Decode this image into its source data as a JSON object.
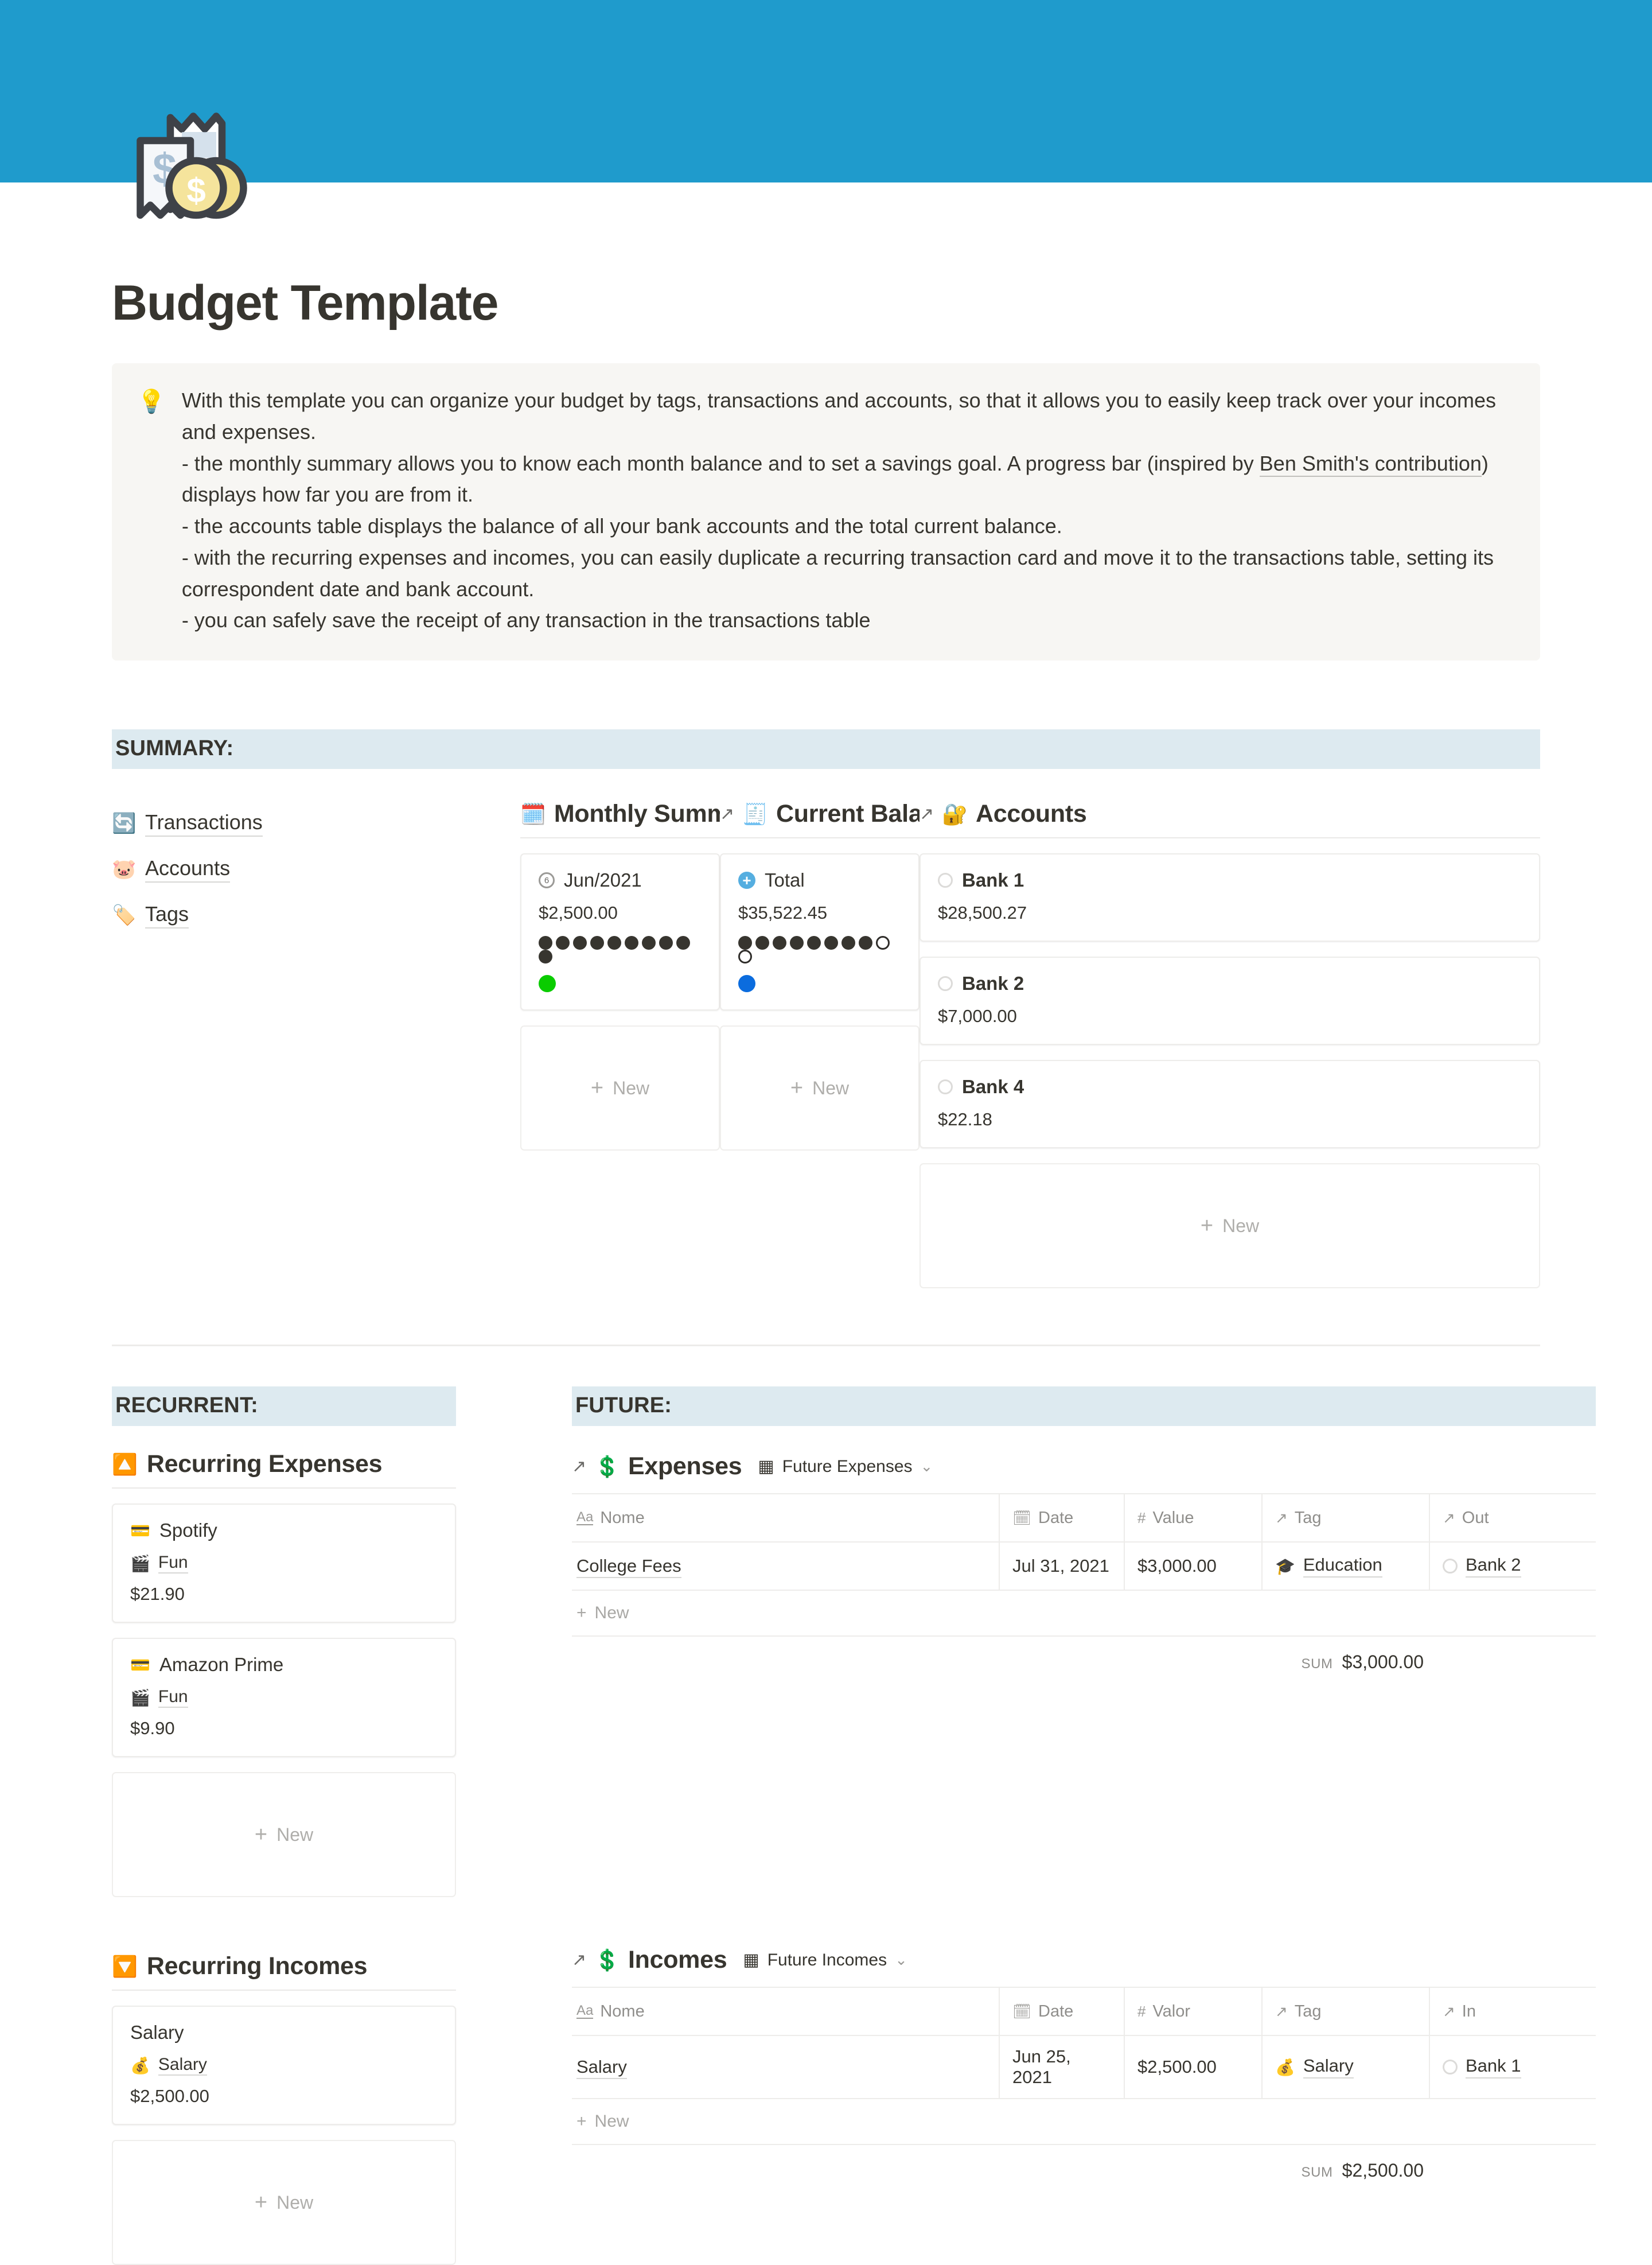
{
  "cover": {
    "color": "#1F9BCC",
    "icon": "receipt-with-coins-icon"
  },
  "page": {
    "title": "Budget Template"
  },
  "callout": {
    "emoji": "💡",
    "line1": "With this template you can organize your budget by tags, transactions and accounts, so that it allows you to easily keep track over your incomes and expenses.",
    "line2a": "- the monthly summary allows you to know each month balance and to set a savings goal. A progress bar (inspired by ",
    "link": "Ben Smith's contribution",
    "line2b": ") displays how far you are from it.",
    "line3": "- the accounts table displays the balance of all your bank accounts and the total current balance.",
    "line4": "- with the recurring expenses and incomes, you can easily duplicate a recurring transaction card and move it to the transactions table, setting its correspondent date and bank account.",
    "line5": "- you can safely save the receipt of any transaction in the transactions table"
  },
  "sections": {
    "summary": "SUMMARY:",
    "recurrent": "RECURRENT:",
    "future": "FUTURE:"
  },
  "quick_links": [
    {
      "emoji": "🔄",
      "label": "Transactions"
    },
    {
      "emoji": "🐷",
      "label": "Accounts"
    },
    {
      "emoji": "🏷️",
      "label": "Tags"
    }
  ],
  "monthly_summary": {
    "emoji": "🗓️",
    "title": "Monthly Summary",
    "view_icon": "table-view-icon",
    "chevron": "chevron-down-icon",
    "card": {
      "date_badge": "6",
      "name": "Jun/2021",
      "value": "$2,500.00",
      "progress_filled": 10,
      "progress_total": 10,
      "status_color": "#0ACC00"
    },
    "new_label": "New"
  },
  "current_balance": {
    "arrow": "open-link-icon",
    "emoji": "🧾",
    "title": "Current Balance",
    "card": {
      "name": "Total",
      "value": "$35,522.45",
      "progress_filled": 8,
      "progress_total": 10,
      "status_color": "#0B6CDE"
    },
    "new_label": "New"
  },
  "accounts_board": {
    "arrow": "open-link-icon",
    "emoji": "🔐",
    "title": "Accounts",
    "cards": [
      {
        "name": "Bank 1",
        "value": "$28,500.27"
      },
      {
        "name": "Bank 2",
        "value": "$7,000.00"
      },
      {
        "name": "Bank 4",
        "value": "$22.18"
      }
    ],
    "new_label": "New"
  },
  "recurring_expenses": {
    "emoji": "🔼",
    "title": "Recurring Expenses",
    "cards": [
      {
        "icon_emoji": "💳",
        "name": "Spotify",
        "tag_emoji": "🎬",
        "tag": "Fun",
        "value": "$21.90"
      },
      {
        "icon_emoji": "💳",
        "name": "Amazon Prime",
        "tag_emoji": "🎬",
        "tag": "Fun",
        "value": "$9.90"
      }
    ],
    "new_label": "New"
  },
  "recurring_incomes": {
    "emoji": "🔽",
    "title": "Recurring Incomes",
    "cards": [
      {
        "name": "Salary",
        "tag_emoji": "💰",
        "tag": "Salary",
        "value": "$2,500.00"
      }
    ],
    "new_label": "New"
  },
  "expenses_table": {
    "arrow": "open-link-icon",
    "emoji": "💲",
    "title": "Expenses",
    "view_icon": "table-view-icon",
    "view_name": "Future Expenses",
    "chevron": "chevron-down-icon",
    "columns": [
      "Nome",
      "Date",
      "Value",
      "Tag",
      "Out"
    ],
    "rows": [
      {
        "nome": "College Fees",
        "date": "Jul 31, 2021",
        "value": "$3,000.00",
        "tag_emoji": "🎓",
        "tag": "Education",
        "account": "Bank 2"
      }
    ],
    "new_label": "New",
    "sum_label": "SUM",
    "sum_value": "$3,000.00"
  },
  "incomes_table": {
    "arrow": "open-link-icon",
    "emoji": "💲",
    "title": "Incomes",
    "view_icon": "table-view-icon",
    "view_name": "Future Incomes",
    "chevron": "chevron-down-icon",
    "columns": [
      "Nome",
      "Date",
      "Valor",
      "Tag",
      "In"
    ],
    "rows": [
      {
        "nome": "Salary",
        "date": "Jun 25, 2021",
        "value": "$2,500.00",
        "tag_emoji": "💰",
        "tag": "Salary",
        "account": "Bank 1"
      }
    ],
    "new_label": "New",
    "sum_label": "SUM",
    "sum_value": "$2,500.00"
  }
}
